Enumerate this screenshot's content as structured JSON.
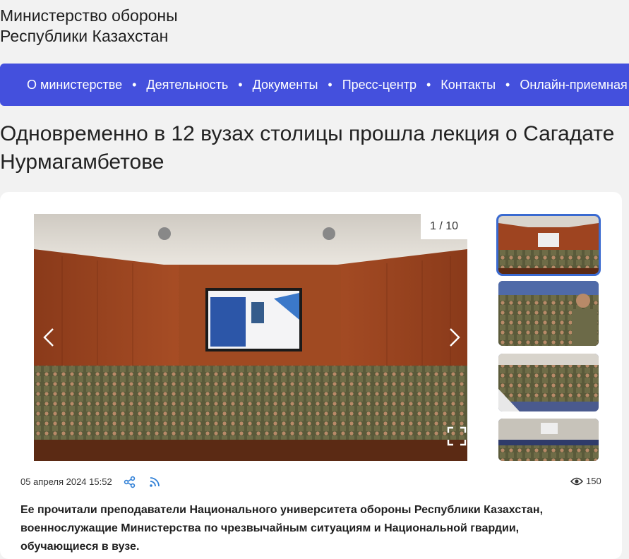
{
  "site": {
    "org_line1": "Министерство обороны",
    "org_line2": "Республики Казахстан"
  },
  "nav": {
    "items": [
      "О министерстве",
      "Деятельность",
      "Документы",
      "Пресс-центр",
      "Контакты",
      "Онлайн-приемная"
    ],
    "separator": "•",
    "background": "#4450dd"
  },
  "article": {
    "title": "Одновременно в 12 вузах столицы прошла лекция о Сагадате Нурмагамбетове",
    "gallery": {
      "counter": "1 / 10",
      "prev_icon": "chevron-left-icon",
      "next_icon": "chevron-right-icon",
      "fullscreen_icon": "expand-icon",
      "thumbnails": 4
    },
    "date": "05 апреля 2024 15:52",
    "views": "150",
    "lead": "Ее прочитали преподаватели Национального университета обороны Республики Казахстан, военнослужащие Министерства по чрезвычайным ситуациям и Национальной гвардии, обучающиеся в вузе."
  }
}
